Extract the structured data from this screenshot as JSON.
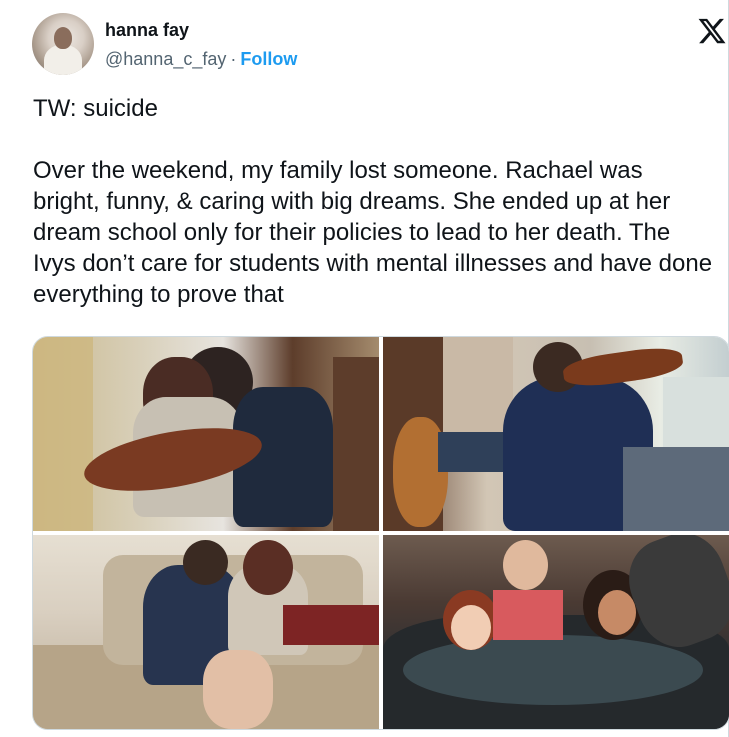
{
  "author": {
    "name": "hanna fay",
    "handle": "@hanna_c_fay",
    "separator": "·",
    "follow_label": "Follow"
  },
  "tweet": {
    "warning": "TW: suicide",
    "body": "Over the weekend, my family lost someone. Rachael was bright, funny, & caring with big dreams. She ended up at her dream school only for their policies to lead to her death. The Ivys don’t care for students with mental illnesses and have done everything to prove that"
  },
  "icons": {
    "platform": "x-logo-icon"
  },
  "colors": {
    "text": "#0f1419",
    "secondary_text": "#536471",
    "link": "#1d9bf0",
    "border": "#cfd9de"
  },
  "media": {
    "photo_count": 4
  }
}
